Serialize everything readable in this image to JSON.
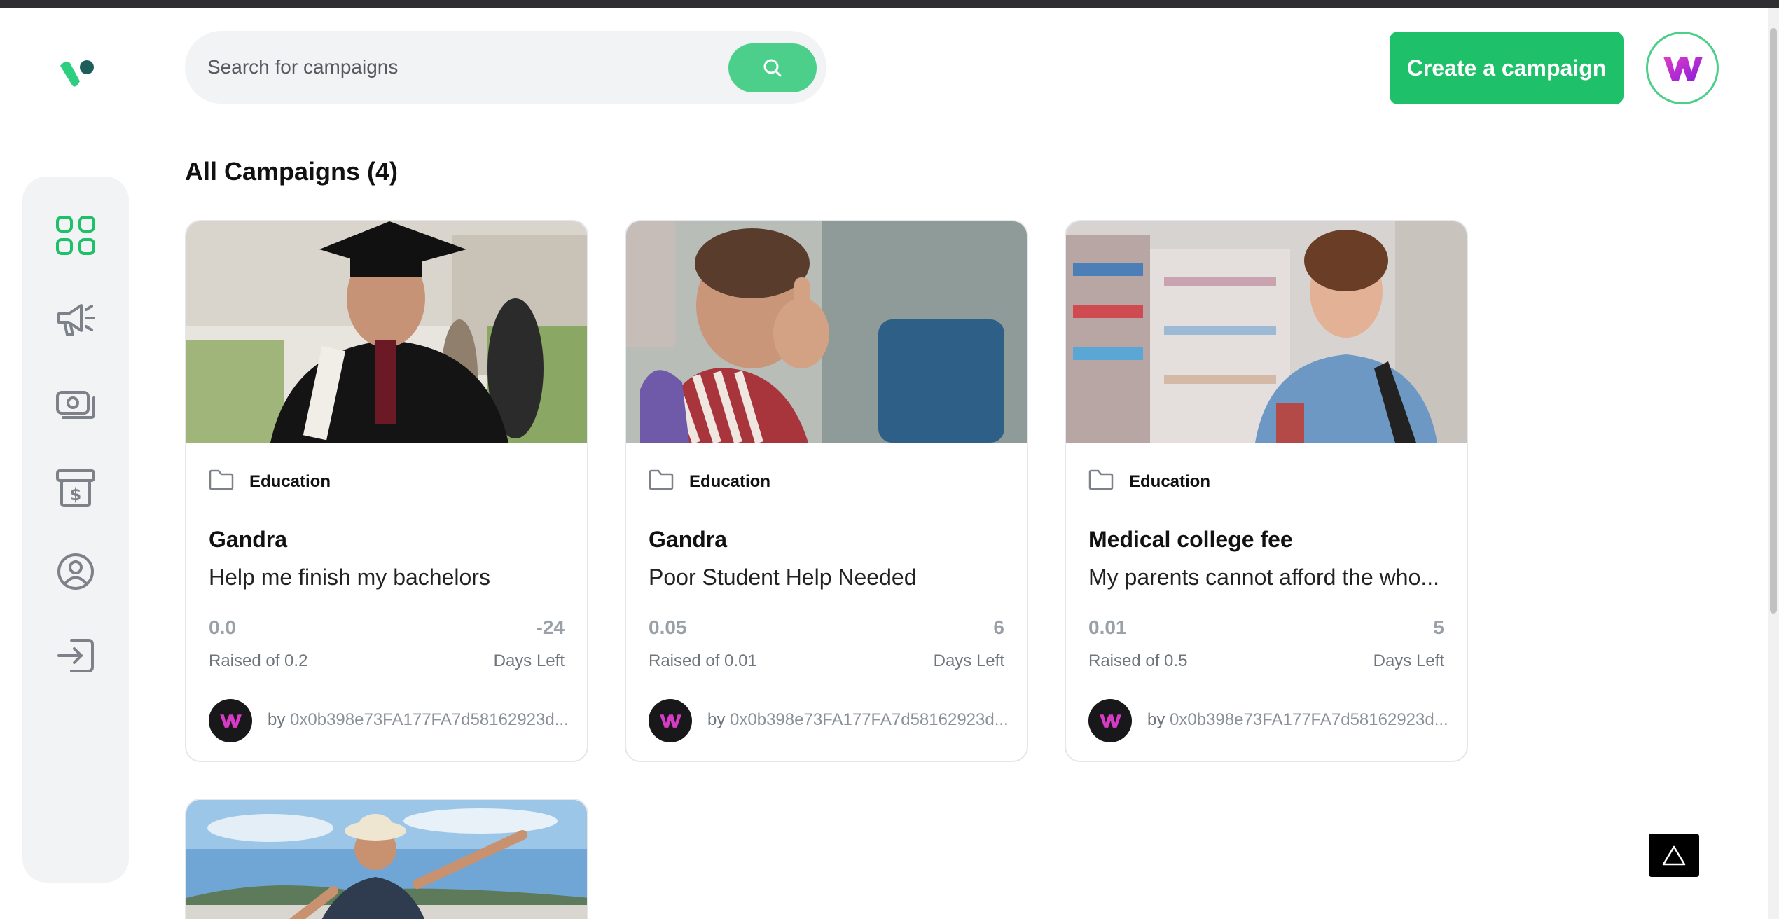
{
  "brand": {
    "logo_icon": "app-logo-icon",
    "accent": "#1ec06a",
    "accent_light": "#4ccf8a"
  },
  "search": {
    "placeholder": "Search for campaigns",
    "value": "",
    "button_icon": "search-icon"
  },
  "header": {
    "create_label": "Create a campaign",
    "profile_icon": "profile-logo-icon"
  },
  "sidebar": {
    "items": [
      {
        "name": "dashboard",
        "icon": "dashboard-grid-icon",
        "active": true
      },
      {
        "name": "campaign",
        "icon": "megaphone-icon",
        "active": false
      },
      {
        "name": "payment",
        "icon": "payment-icon",
        "active": false
      },
      {
        "name": "withdraw",
        "icon": "withdraw-icon",
        "active": false
      },
      {
        "name": "profile",
        "icon": "user-icon",
        "active": false
      },
      {
        "name": "logout",
        "icon": "logout-icon",
        "active": false
      }
    ]
  },
  "main": {
    "title": "All Campaigns (4)",
    "campaigns": [
      {
        "category": "Education",
        "title": "Gandra",
        "description": "Help me finish my bachelors",
        "raised": "0.0",
        "raised_label": "Raised of 0.2",
        "days": "-24",
        "days_label": "Days Left",
        "owner_prefix": "by",
        "owner": "0x0b398e73FA177FA7d58162923d..."
      },
      {
        "category": "Education",
        "title": "Gandra",
        "description": "Poor Student Help Needed",
        "raised": "0.05",
        "raised_label": "Raised of 0.01",
        "days": "6",
        "days_label": "Days Left",
        "owner_prefix": "by",
        "owner": "0x0b398e73FA177FA7d58162923d..."
      },
      {
        "category": "Education",
        "title": "Medical college fee",
        "description": "My parents cannot afford the who...",
        "raised": "0.01",
        "raised_label": "Raised of 0.5",
        "days": "5",
        "days_label": "Days Left",
        "owner_prefix": "by",
        "owner": "0x0b398e73FA177FA7d58162923d..."
      }
    ]
  },
  "help": {
    "icon": "triangle-icon"
  }
}
